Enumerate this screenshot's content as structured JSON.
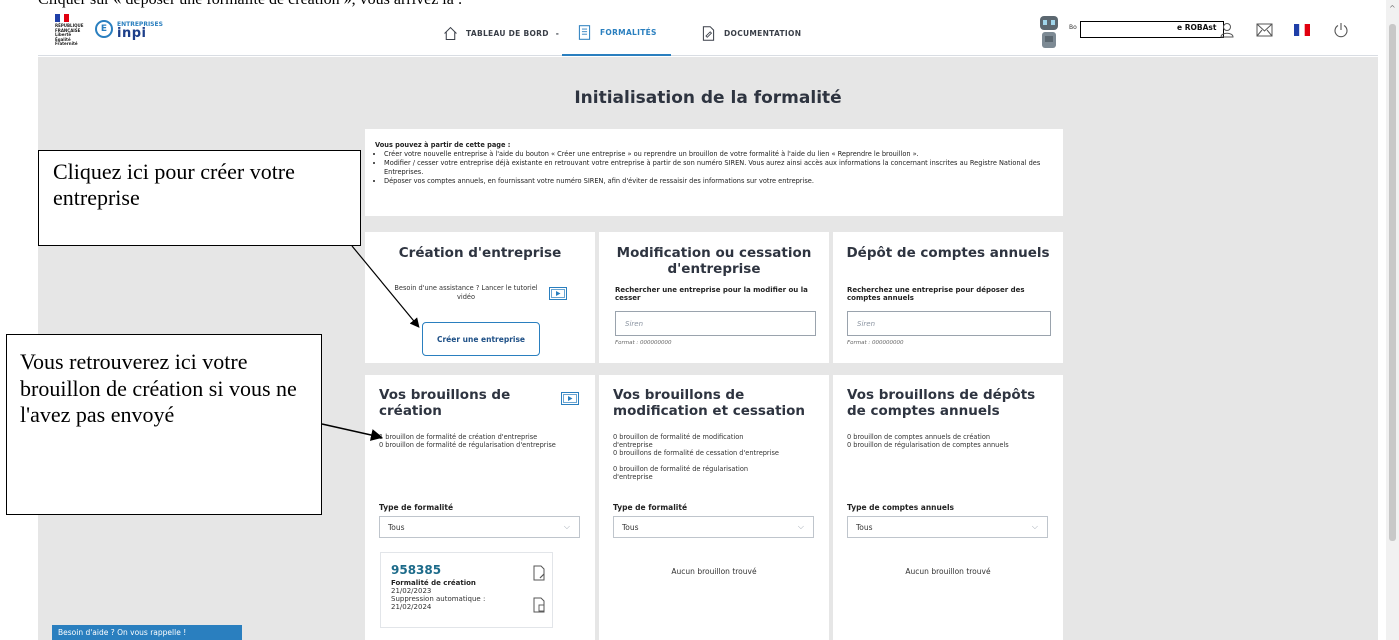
{
  "doc_caption": "Cliquer sur « déposer une formalité de création », vous arrivez là :",
  "header": {
    "rf_logo_text": "RÉPUBLIQUE FRANÇAISE Liberté Égalité Fraternité",
    "inpi_small": "ENTREPRISES",
    "inpi_big": "inpi",
    "nav": [
      {
        "label": "TABLEAU DE BORD",
        "suffix": "-",
        "icon": "home-icon",
        "active": false
      },
      {
        "label": "FORMALITÉS",
        "icon": "document-icon",
        "active": true
      },
      {
        "label": "DOCUMENTATION",
        "icon": "doc-edit-icon",
        "active": false
      }
    ],
    "user_prefix": "Bo",
    "user_name": "e ROBAst",
    "icons": [
      "user-icon",
      "mail-icon",
      "french-flag-icon",
      "power-icon"
    ],
    "colors": {
      "accent": "#2a7fbf",
      "flag_blue": "#1f3fa8",
      "flag_red": "#e1000f"
    }
  },
  "page": {
    "title": "Initialisation de la formalité",
    "intro": {
      "head": "Vous pouvez à partir de cette page :",
      "items": [
        "Créer votre nouvelle entreprise à l'aide du bouton « Créer une entreprise » ou reprendre un brouillon de votre formalité à l'aide du lien « Reprendre le brouillon ».",
        "Modifier / cesser votre entreprise déjà existante en retrouvant votre entreprise à partir de son numéro SIREN. Vous aurez ainsi accès aux informations la concernant inscrites au Registre National des Entreprises.",
        "Déposer vos comptes annuels, en fournissant votre numéro SIREN, afin d'éviter de ressaisir des informations sur votre entreprise."
      ]
    },
    "creation": {
      "title": "Création d'entreprise",
      "assist": "Besoin d'une assistance ? Lancer le tutoriel vidéo",
      "button": "Créer une entreprise"
    },
    "modification": {
      "title": "Modification ou cessation d'entreprise",
      "search_label": "Rechercher une entreprise pour la modifier ou la cesser",
      "placeholder": "Siren",
      "format": "Format : 000000000"
    },
    "depot": {
      "title": "Dépôt de comptes annuels",
      "search_label": "Recherchez une entreprise pour déposer des comptes annuels",
      "placeholder": "Siren",
      "format": "Format : 000000000"
    },
    "drafts_creation": {
      "title": "Vos brouillons de création",
      "lines": [
        "1 brouillon de formalité de création d'entreprise",
        "0 brouillon de formalité de régularisation d'entreprise"
      ],
      "filter_label": "Type de formalité",
      "filter_value": "Tous",
      "draft": {
        "number": "958385",
        "kind": "Formalité de création",
        "date": "21/02/2023",
        "auto_delete_label": "Suppression automatique :",
        "auto_delete_date": "21/02/2024"
      }
    },
    "drafts_modification": {
      "title": "Vos brouillons de modification et cessation",
      "lines": [
        "0 brouillon de formalité de modification d'entreprise",
        "0 brouillons de formalité de cessation d'entreprise",
        "0 brouillon de formalité de régularisation d'entreprise"
      ],
      "filter_label": "Type de formalité",
      "filter_value": "Tous",
      "empty": "Aucun brouillon trouvé"
    },
    "drafts_depot": {
      "title": "Vos brouillons de dépôts de comptes annuels",
      "lines": [
        "0 brouillon de comptes annuels de création",
        "0 brouillon de régularisation de comptes annuels"
      ],
      "filter_label": "Type de comptes annuels",
      "filter_value": "Tous",
      "empty": "Aucun brouillon trouvé"
    },
    "help_button": "Besoin d'aide ? On vous rappelle !"
  },
  "callouts": {
    "create": "Cliquez ici pour créer votre entreprise",
    "drafts": "Vous retrouverez ici votre brouillon de création si vous ne l'avez pas envoyé"
  }
}
